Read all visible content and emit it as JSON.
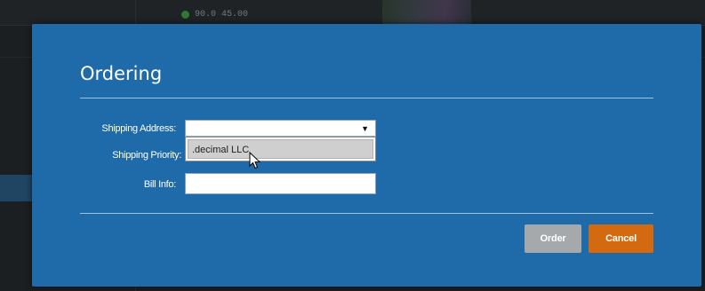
{
  "background": {
    "readout_values": [
      "90.0",
      "45.00"
    ]
  },
  "dialog": {
    "title": "Ordering",
    "fields": {
      "shipping_address_label": "Shipping Address:",
      "shipping_priority_label": "Shipping Priority:",
      "bill_info_label": "Bill Info:",
      "shipping_address_value": "",
      "bill_info_value": ""
    },
    "dropdown": {
      "options": [
        ".decimal LLC"
      ],
      "highlighted_index": 0
    },
    "buttons": {
      "order_label": "Order",
      "cancel_label": "Cancel"
    }
  },
  "colors": {
    "dialog_bg": "#1f6aa8",
    "order_button": "#a5a9ac",
    "cancel_button": "#d46a0f",
    "option_highlight": "#cfcfcf"
  },
  "icons": {
    "dropdown_arrow": "chevron-down-icon",
    "pointer": "mouse-pointer-icon"
  }
}
